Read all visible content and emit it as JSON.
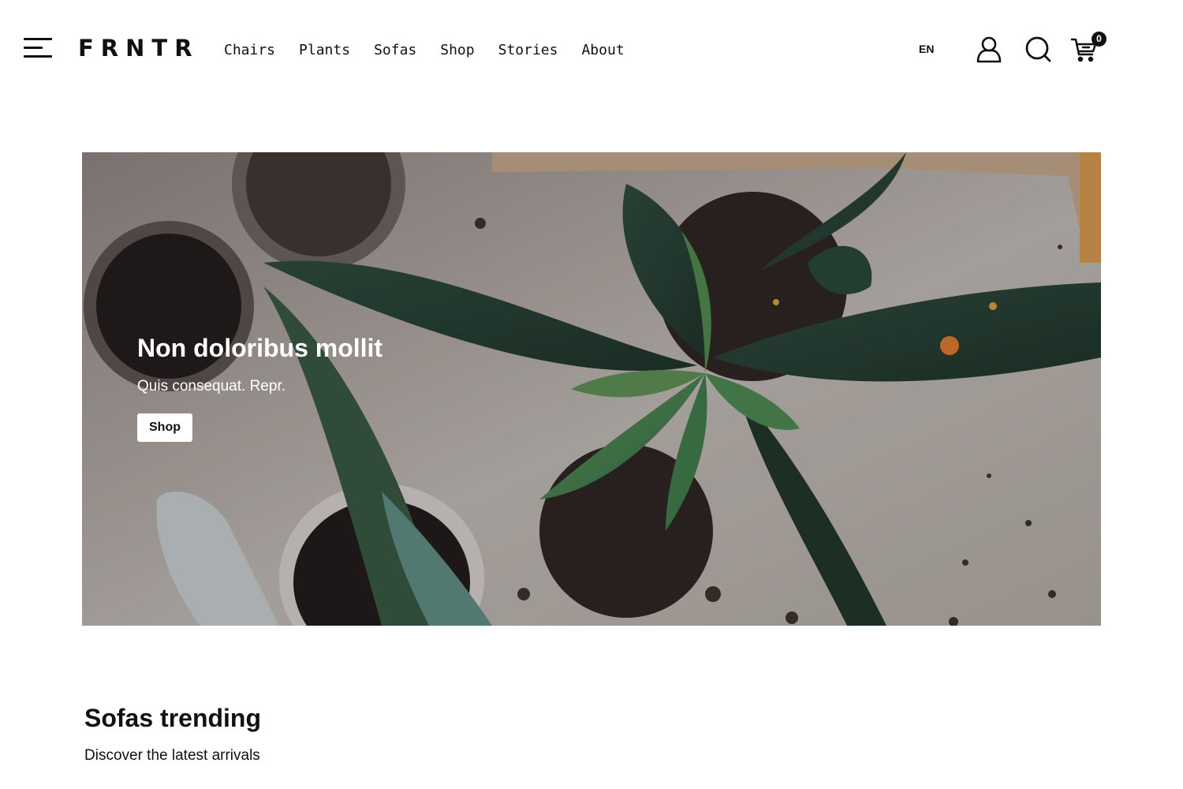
{
  "header": {
    "logo": "FRNTR",
    "nav": [
      "Chairs",
      "Plants",
      "Sofas",
      "Shop",
      "Stories",
      "About"
    ],
    "language": "EN",
    "cart_count": "0",
    "icons": [
      "menu-icon",
      "user-icon",
      "search-icon",
      "cart-icon"
    ]
  },
  "hero": {
    "title": "Non doloribus mollit",
    "subtitle": "Quis consequat. Repr.",
    "button_label": "Shop"
  },
  "section": {
    "title": "Sofas trending",
    "subtitle": "Discover the latest arrivals"
  },
  "colors": {
    "text": "#111111",
    "background": "#ffffff",
    "button_bg": "#ffffff"
  }
}
